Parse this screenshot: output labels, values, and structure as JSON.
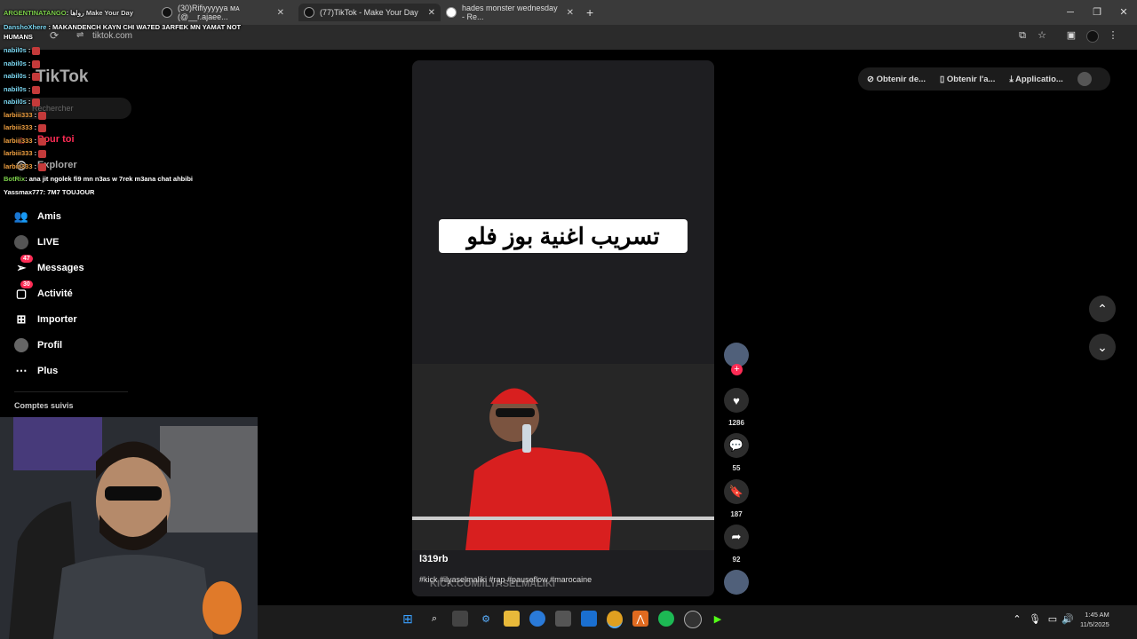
{
  "browser": {
    "tabs": [
      {
        "label": "(30)Rifiyyyyya ᴍᴀ (@__r.ajaee..."
      },
      {
        "label": "(77)TikTok - Make Your Day"
      },
      {
        "label": "hades monster wednesday - Re..."
      }
    ],
    "url": "tiktok.com"
  },
  "chat": {
    "lines": [
      {
        "user": "ARGENTINATANGO",
        "text": ": رواها Make Your Day",
        "color": "#7cd04a"
      },
      {
        "user": "DanshoXhere",
        "text": ": MAKANDENCH KAYN CHI WA7ED 3ARFEK MN YAMAT NOT HUMANS",
        "color": "#7ad6f0"
      },
      {
        "user": "nabil0s",
        "text": " :",
        "color": "#7ad6f0"
      },
      {
        "user": "nabil0s",
        "text": " :",
        "color": "#7ad6f0"
      },
      {
        "user": "nabil0s",
        "text": " :",
        "color": "#7ad6f0"
      },
      {
        "user": "nabil0s",
        "text": " :",
        "color": "#7ad6f0"
      },
      {
        "user": "nabil0s",
        "text": " :",
        "color": "#7ad6f0"
      },
      {
        "user": "larbiii333",
        "text": " :",
        "color": "#f0a040"
      },
      {
        "user": "larbiii333",
        "text": " :",
        "color": "#f0a040"
      },
      {
        "user": "larbiii333",
        "text": " :",
        "color": "#f0a040"
      },
      {
        "user": "larbiii333",
        "text": " :",
        "color": "#f0a040"
      },
      {
        "user": "larbiii333",
        "text": " :",
        "color": "#f0a040"
      },
      {
        "user": "BotRix",
        "text": ": ana   jit ngolek fi9 mn n3as w 7rek m3ana chat ahbibi",
        "color": "#7cd04a"
      },
      {
        "user": "Yassmax777",
        "text": ": 7M7 TOUJOUR",
        "color": "#ffffff"
      }
    ]
  },
  "tiktok": {
    "logo": "TikTok",
    "search_placeholder": "Rechercher",
    "nav": {
      "for_you": "Pour toi",
      "explore": "Explorer",
      "friends": "Amis",
      "live": "LIVE",
      "messages": "Messages",
      "messages_badge": "47",
      "activity": "Activité",
      "activity_badge": "30",
      "upload": "Importer",
      "profile": "Profil",
      "more": "Plus"
    },
    "following_header": "Comptes suivis",
    "top_actions": {
      "get_coins": "Obtenir de...",
      "get_app": "Obtenir l'a...",
      "application": "Applicatio..."
    },
    "video": {
      "overlay_title": "تسريب اغنية بوز فلو",
      "author": "l319rb",
      "hashtags": "#kick #ilyaselmaliki #rap #pauseflow #marocaine",
      "watermark": "KICK.COM/ILYASELMALIKI",
      "likes": "1286",
      "comments": "55",
      "saves": "187",
      "shares": "92"
    }
  },
  "system": {
    "time": "1:45 AM",
    "date": "11/5/2025"
  }
}
